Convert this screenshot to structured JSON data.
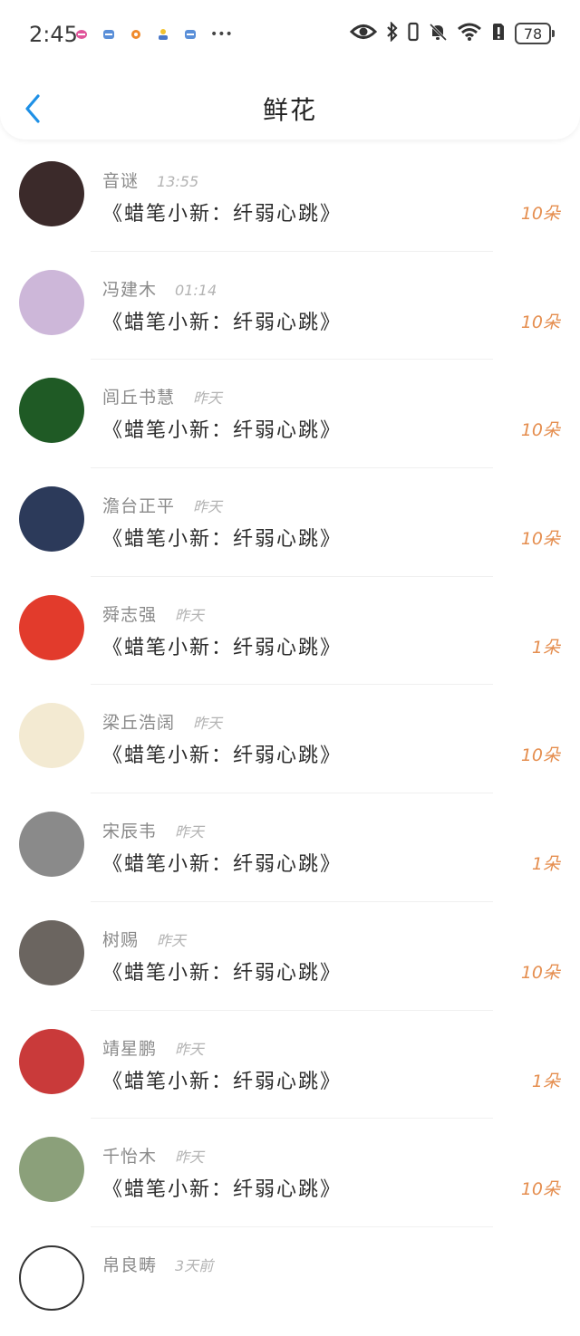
{
  "status_bar": {
    "time": "2:45",
    "battery": "78",
    "more_dots": "•••"
  },
  "nav": {
    "title": "鲜花"
  },
  "colors": {
    "accent_blue": "#1e90e6",
    "count_orange": "#e58e4f"
  },
  "rows": [
    {
      "name": "音谜",
      "time": "13:55",
      "title": "《蜡笔小新：纤弱心跳》",
      "count": "10朵",
      "avatar": "#3b2a2a"
    },
    {
      "name": "冯建木",
      "time": "01:14",
      "title": "《蜡笔小新：纤弱心跳》",
      "count": "10朵",
      "avatar": "#cdb7d9"
    },
    {
      "name": "闾丘书慧",
      "time": "昨天",
      "title": "《蜡笔小新：纤弱心跳》",
      "count": "10朵",
      "avatar": "#1f5a25"
    },
    {
      "name": "澹台正平",
      "time": "昨天",
      "title": "《蜡笔小新：纤弱心跳》",
      "count": "10朵",
      "avatar": "#2c3a5a"
    },
    {
      "name": "舜志强",
      "time": "昨天",
      "title": "《蜡笔小新：纤弱心跳》",
      "count": "1朵",
      "avatar": "#e23b2c"
    },
    {
      "name": "梁丘浩阔",
      "time": "昨天",
      "title": "《蜡笔小新：纤弱心跳》",
      "count": "10朵",
      "avatar": "#f3ead2"
    },
    {
      "name": "宋辰韦",
      "time": "昨天",
      "title": "《蜡笔小新：纤弱心跳》",
      "count": "1朵",
      "avatar": "#8a8a8a"
    },
    {
      "name": "树赐",
      "time": "昨天",
      "title": "《蜡笔小新：纤弱心跳》",
      "count": "10朵",
      "avatar": "#6b6560"
    },
    {
      "name": "靖星鹏",
      "time": "昨天",
      "title": "《蜡笔小新：纤弱心跳》",
      "count": "1朵",
      "avatar": "#c93a3a"
    },
    {
      "name": "千怡木",
      "time": "昨天",
      "title": "《蜡笔小新：纤弱心跳》",
      "count": "10朵",
      "avatar": "#8ba07a"
    },
    {
      "name": "帛良畴",
      "time": "3天前",
      "title": "",
      "count": "",
      "avatar": "#ffffff"
    }
  ]
}
